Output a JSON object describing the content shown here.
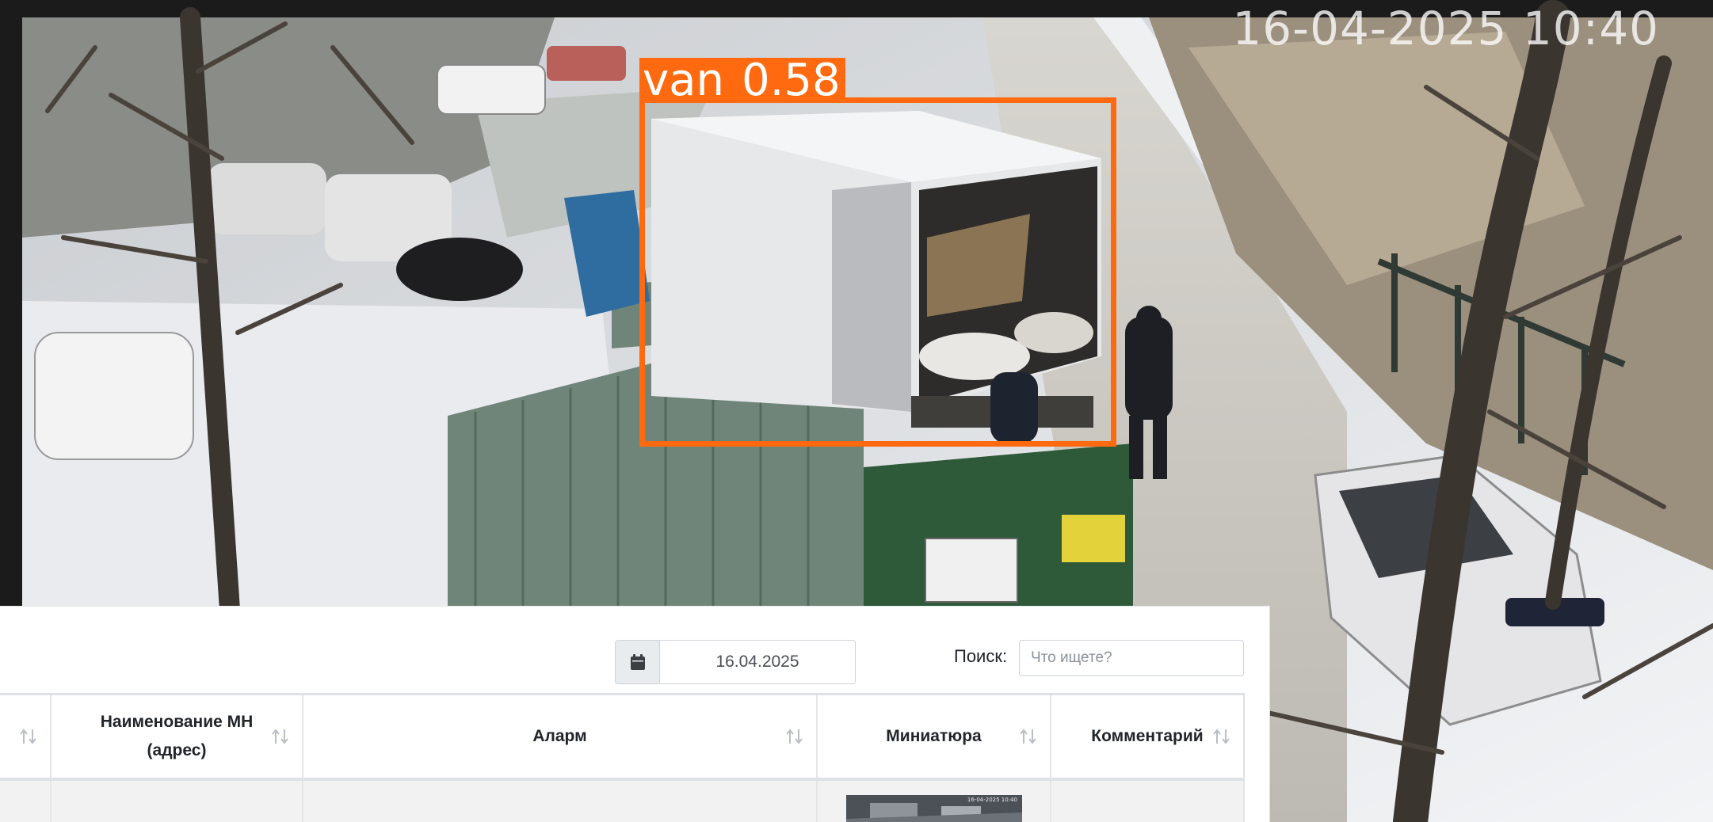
{
  "camera": {
    "timestamp": "16-04-2025 10:40",
    "detection": {
      "class_name": "van",
      "confidence": "0.58",
      "box_color": "#ff6a10"
    }
  },
  "filters": {
    "date_value": "16.04.2025",
    "calendar_icon": "calendar-icon",
    "search_label": "Поиск:",
    "search_placeholder": "Что ищете?"
  },
  "table": {
    "columns": [
      {
        "label": ""
      },
      {
        "label": "Наименование МН (адрес)"
      },
      {
        "label": "Аларм"
      },
      {
        "label": "Миниатюра"
      },
      {
        "label": "Комментарий"
      }
    ],
    "sort_icon": "sort-arrows-icon",
    "rows": [
      {
        "thumbnail_timestamp": "16-04-2025 10:40"
      }
    ]
  },
  "colors": {
    "detection_box": "#ff6a10",
    "table_header_border": "#dee2e6",
    "row_background": "#f2f2f2",
    "date_addon": "#e9ecef"
  }
}
